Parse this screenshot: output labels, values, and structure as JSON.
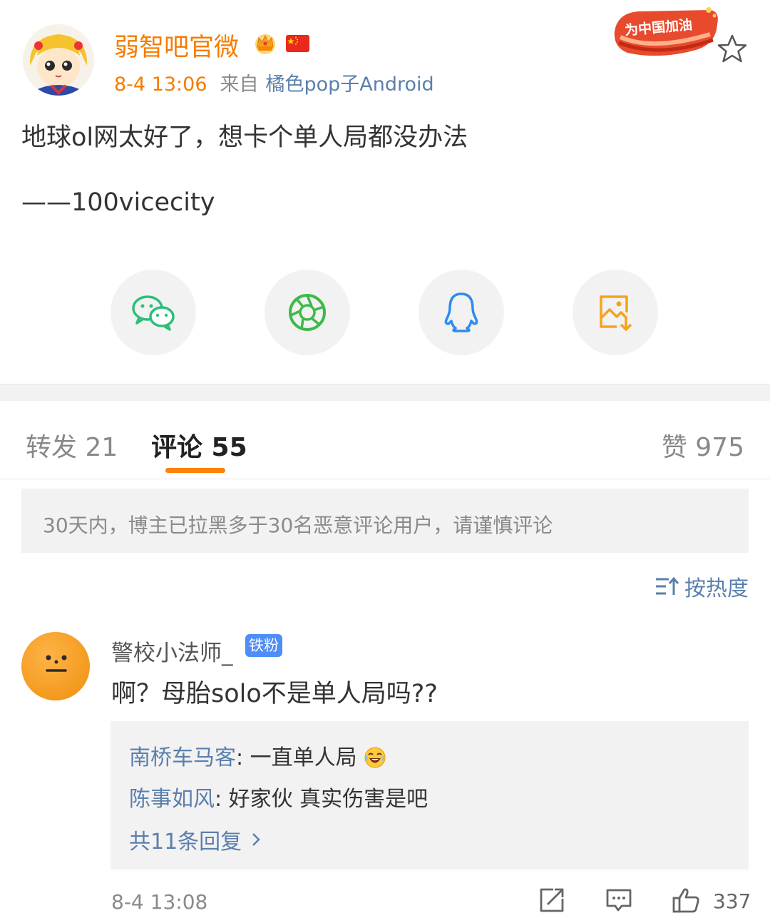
{
  "post": {
    "author": "弱智吧官微",
    "time": "8-4 13:06",
    "from_label": "来自",
    "source": "橘色pop子Android",
    "badge_text": "为中国加油",
    "text_line1": "地球ol网太好了，想卡个单人局都没办法",
    "text_line2": "——100vicecity"
  },
  "share": {
    "items": [
      {
        "icon": "wechat-icon",
        "color": "#2bbf7a"
      },
      {
        "icon": "moments-icon",
        "color": "#3cba4a"
      },
      {
        "icon": "qq-icon",
        "color": "#2d8cf0"
      },
      {
        "icon": "save-image-icon",
        "color": "#f7a21b"
      }
    ]
  },
  "tabs": {
    "repost": "转发 21",
    "comment": "评论 55",
    "like": "赞 975"
  },
  "notice": "30天内，博主已拉黑多于30名恶意评论用户，请谨慎评论",
  "sort": {
    "label": "按热度"
  },
  "comment": {
    "user": "警校小法师_",
    "badge": "铁粉",
    "text": "啊？母胎solo不是单人局吗??",
    "replies": [
      {
        "user": "南桥车马客",
        "text": ": 一直单人局"
      },
      {
        "user": "陈事如风",
        "text": ": 好家伙 真实伤害是吧"
      }
    ],
    "more_replies": "共11条回复",
    "time": "8-4 13:08",
    "likes": "337"
  },
  "colors": {
    "accent": "#ff8200",
    "author": "#f57c00",
    "link": "#5b7fad",
    "muted": "#8a8a8a",
    "band": "#f2f2f2"
  }
}
